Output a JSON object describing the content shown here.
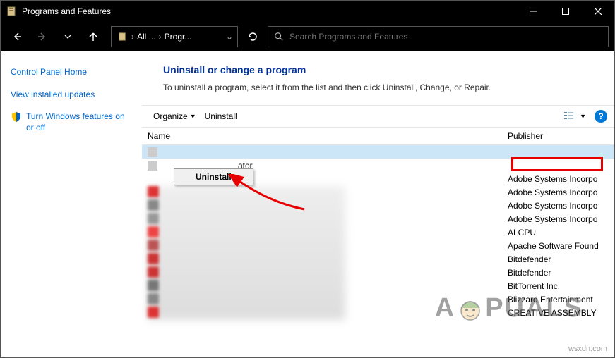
{
  "window": {
    "title": "Programs and Features"
  },
  "breadcrumb": {
    "seg1": "All ...",
    "seg2": "Progr..."
  },
  "search": {
    "placeholder": "Search Programs and Features"
  },
  "sidebar": {
    "home": "Control Panel Home",
    "updates": "View installed updates",
    "features": "Turn Windows features on or off"
  },
  "main": {
    "heading": "Uninstall or change a program",
    "subtitle": "To uninstall a program, select it from the list and then click Uninstall, Change, or Repair."
  },
  "toolbar": {
    "organize": "Organize",
    "uninstall": "Uninstall"
  },
  "columns": {
    "name": "Name",
    "publisher": "Publisher"
  },
  "context_menu": {
    "uninstall": "Uninstall"
  },
  "visible_row_fragment": "ator",
  "publishers": [
    "Adobe Systems Incorpo",
    "Adobe Systems Incorpo",
    "Adobe Systems Incorpo",
    "Adobe Systems Incorpo",
    "ALCPU",
    "Apache Software Found",
    "Bitdefender",
    "Bitdefender",
    "BitTorrent Inc.",
    "Blizzard Entertainment",
    "CREATIVE ASSEMBLY"
  ],
  "watermark": {
    "left": "A",
    "right": "PUALS"
  },
  "footer_mark": "wsxdn.com"
}
